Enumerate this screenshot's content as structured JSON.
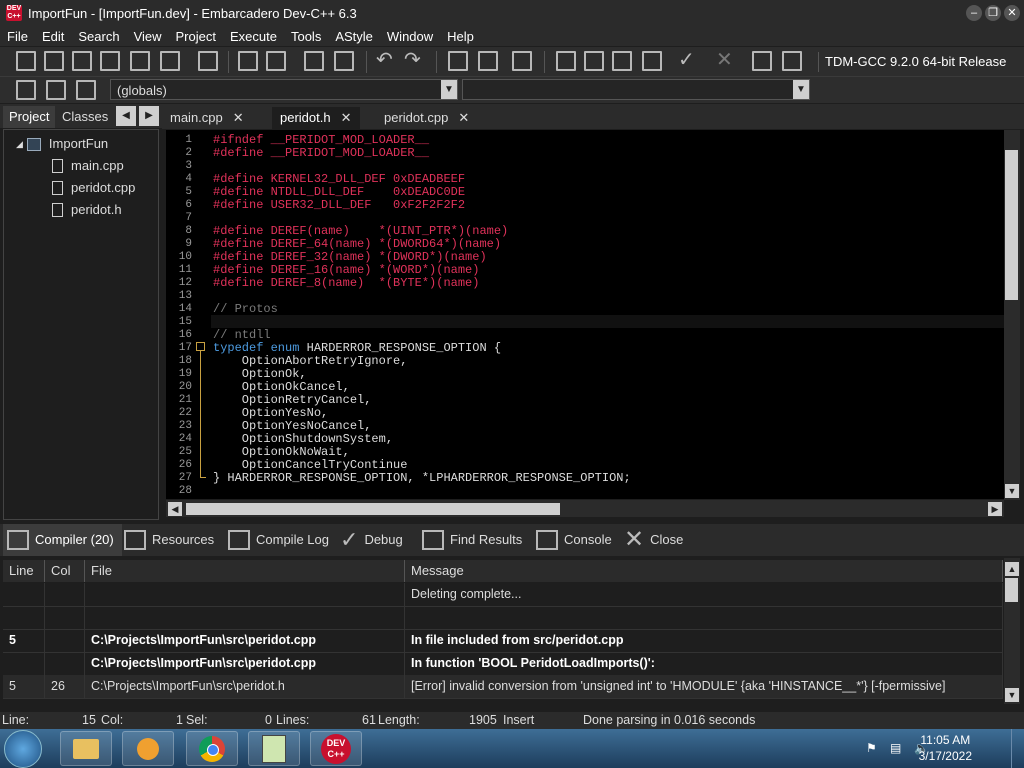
{
  "window": {
    "title": "ImportFun - [ImportFun.dev] - Embarcadero Dev-C++ 6.3",
    "app_icon_text": "DEV C++"
  },
  "menu": [
    "File",
    "Edit",
    "Search",
    "View",
    "Project",
    "Execute",
    "Tools",
    "AStyle",
    "Window",
    "Help"
  ],
  "toolbar": {
    "compiler": "TDM-GCC 9.2.0 64-bit Release",
    "scope_select": "(globals)",
    "function_select": ""
  },
  "left_panel": {
    "tabs": [
      "Project",
      "Classes"
    ],
    "active_tab": "Project",
    "tree": {
      "project": "ImportFun",
      "files": [
        "main.cpp",
        "peridot.cpp",
        "peridot.h"
      ]
    }
  },
  "editor": {
    "tabs": [
      {
        "label": "main.cpp",
        "active": false,
        "closable": true
      },
      {
        "label": "peridot.h",
        "active": true,
        "closable": true
      },
      {
        "label": "peridot.cpp",
        "active": false,
        "closable": true
      }
    ],
    "lines": [
      {
        "n": "1",
        "text": "#ifndef __PERIDOT_MOD_LOADER__",
        "cls": "pp"
      },
      {
        "n": "2",
        "text": "#define __PERIDOT_MOD_LOADER__",
        "cls": "pp"
      },
      {
        "n": "3",
        "text": "",
        "cls": ""
      },
      {
        "n": "4",
        "text": "#define KERNEL32_DLL_DEF 0xDEADBEEF",
        "cls": "pp"
      },
      {
        "n": "5",
        "text": "#define NTDLL_DLL_DEF    0xDEADC0DE",
        "cls": "pp"
      },
      {
        "n": "6",
        "text": "#define USER32_DLL_DEF   0xF2F2F2F2",
        "cls": "pp"
      },
      {
        "n": "7",
        "text": "",
        "cls": ""
      },
      {
        "n": "8",
        "text": "#define DEREF(name)    *(UINT_PTR*)(name)",
        "cls": "pp"
      },
      {
        "n": "9",
        "text": "#define DEREF_64(name) *(DWORD64*)(name)",
        "cls": "pp"
      },
      {
        "n": "10",
        "text": "#define DEREF_32(name) *(DWORD*)(name)",
        "cls": "pp"
      },
      {
        "n": "11",
        "text": "#define DEREF_16(name) *(WORD*)(name)",
        "cls": "pp"
      },
      {
        "n": "12",
        "text": "#define DEREF_8(name)  *(BYTE*)(name)",
        "cls": "pp"
      },
      {
        "n": "13",
        "text": "",
        "cls": ""
      },
      {
        "n": "14",
        "text": "// Protos",
        "cls": "cm"
      },
      {
        "n": "15",
        "text": "",
        "cls": ""
      },
      {
        "n": "16",
        "text": "// ntdll",
        "cls": "cm"
      },
      {
        "n": "17",
        "text": "typedef enum HARDERROR_RESPONSE_OPTION {",
        "cls": "kw17"
      },
      {
        "n": "18",
        "text": "    OptionAbortRetryIgnore,",
        "cls": ""
      },
      {
        "n": "19",
        "text": "    OptionOk,",
        "cls": ""
      },
      {
        "n": "20",
        "text": "    OptionOkCancel,",
        "cls": ""
      },
      {
        "n": "21",
        "text": "    OptionRetryCancel,",
        "cls": ""
      },
      {
        "n": "22",
        "text": "    OptionYesNo,",
        "cls": ""
      },
      {
        "n": "23",
        "text": "    OptionYesNoCancel,",
        "cls": ""
      },
      {
        "n": "24",
        "text": "    OptionShutdownSystem,",
        "cls": ""
      },
      {
        "n": "25",
        "text": "    OptionOkNoWait,",
        "cls": ""
      },
      {
        "n": "26",
        "text": "    OptionCancelTryContinue",
        "cls": ""
      },
      {
        "n": "27",
        "text": "} HARDERROR_RESPONSE_OPTION, *LPHARDERROR_RESPONSE_OPTION;",
        "cls": ""
      },
      {
        "n": "28",
        "text": "",
        "cls": ""
      }
    ]
  },
  "bottom_panel": {
    "tabs": [
      "Compiler (20)",
      "Resources",
      "Compile Log",
      "Debug",
      "Find Results",
      "Console",
      "Close"
    ],
    "active_tab": "Compiler (20)",
    "columns": [
      "Line",
      "Col",
      "File",
      "Message"
    ],
    "rows": [
      {
        "line": "",
        "col": "",
        "file": "",
        "message": "Deleting complete...",
        "bold": false
      },
      {
        "line": "",
        "col": "",
        "file": "",
        "message": "",
        "bold": false
      },
      {
        "line": "5",
        "col": "",
        "file": "C:\\Projects\\ImportFun\\src\\peridot.cpp",
        "message": "In file included from src/peridot.cpp",
        "bold": true
      },
      {
        "line": "",
        "col": "",
        "file": "C:\\Projects\\ImportFun\\src\\peridot.cpp",
        "message": "In function 'BOOL PeridotLoadImports()':",
        "bold": true
      },
      {
        "line": "5",
        "col": "26",
        "file": "C:\\Projects\\ImportFun\\src\\peridot.h",
        "message": "[Error] invalid conversion from 'unsigned int' to 'HMODULE' {aka 'HINSTANCE__*'} [-fpermissive]",
        "bold": false
      }
    ]
  },
  "status": {
    "line_label": "Line:",
    "line_val": "15",
    "col_label": "Col:",
    "col_val": "1",
    "sel_label": "Sel:",
    "sel_val": "0",
    "lines_label": "Lines:",
    "lines_val": "61",
    "length_label": "Length:",
    "length_val": "1905",
    "mode": "Insert",
    "message": "Done parsing in 0.016 seconds"
  },
  "taskbar": {
    "time": "11:05 AM",
    "date": "3/17/2022",
    "apps": [
      "file-explorer",
      "media-player",
      "chrome",
      "notepad",
      "dev-cpp"
    ]
  }
}
